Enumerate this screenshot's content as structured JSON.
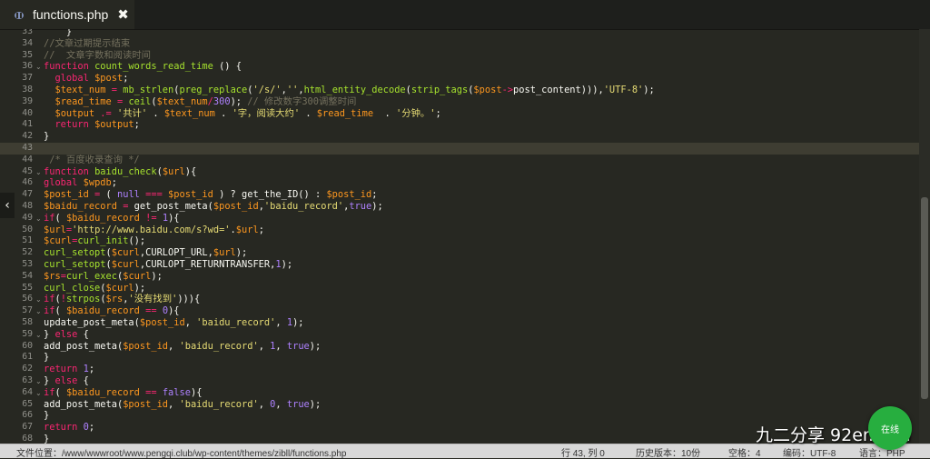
{
  "tab": {
    "title": "functions.php",
    "close": "✖"
  },
  "nav_arrow": "‹",
  "lines": [
    {
      "n": "33",
      "tokens": [
        [
          "    }",
          "plain"
        ]
      ]
    },
    {
      "n": "34",
      "tokens": [
        [
          "//文章过期提示结束",
          "com"
        ]
      ]
    },
    {
      "n": "35",
      "tokens": [
        [
          "//  文章字数和阅读时间",
          "com"
        ]
      ]
    },
    {
      "n": "36",
      "fold": true,
      "tokens": [
        [
          "function",
          "key"
        ],
        [
          " ",
          "plain"
        ],
        [
          "count_words_read_time",
          "fn"
        ],
        [
          " () {",
          "plain"
        ]
      ]
    },
    {
      "n": "37",
      "tokens": [
        [
          "  global",
          "key"
        ],
        [
          " ",
          "plain"
        ],
        [
          "$post",
          "var"
        ],
        [
          ";",
          "plain"
        ]
      ]
    },
    {
      "n": "38",
      "tokens": [
        [
          "  ",
          "plain"
        ],
        [
          "$text_num",
          "var"
        ],
        [
          " = ",
          "key"
        ],
        [
          "mb_strlen",
          "fn"
        ],
        [
          "(",
          "plain"
        ],
        [
          "preg_replace",
          "fn"
        ],
        [
          "(",
          "plain"
        ],
        [
          "'/s/'",
          "str"
        ],
        [
          ",",
          "plain"
        ],
        [
          "''",
          "str"
        ],
        [
          ",",
          "plain"
        ],
        [
          "html_entity_decode",
          "fn"
        ],
        [
          "(",
          "plain"
        ],
        [
          "strip_tags",
          "fn"
        ],
        [
          "(",
          "plain"
        ],
        [
          "$post",
          "var"
        ],
        [
          "->",
          "key"
        ],
        [
          "post_content",
          "plain"
        ],
        [
          "))),",
          "plain"
        ],
        [
          "'UTF-8'",
          "str"
        ],
        [
          ");",
          "plain"
        ]
      ]
    },
    {
      "n": "39",
      "tokens": [
        [
          "  ",
          "plain"
        ],
        [
          "$read_time",
          "var"
        ],
        [
          " = ",
          "key"
        ],
        [
          "ceil",
          "fn"
        ],
        [
          "(",
          "plain"
        ],
        [
          "$text_num",
          "var"
        ],
        [
          "/",
          "key"
        ],
        [
          "300",
          "num"
        ],
        [
          "); ",
          "plain"
        ],
        [
          "// 修改数字300调整时间",
          "com"
        ]
      ]
    },
    {
      "n": "40",
      "tokens": [
        [
          "  ",
          "plain"
        ],
        [
          "$output",
          "var"
        ],
        [
          " .= ",
          "key"
        ],
        [
          "'共计'",
          "str"
        ],
        [
          " . ",
          "plain"
        ],
        [
          "$text_num",
          "var"
        ],
        [
          " . ",
          "plain"
        ],
        [
          "'字，阅读大约'",
          "str"
        ],
        [
          " . ",
          "plain"
        ],
        [
          "$read_time",
          "var"
        ],
        [
          "  . ",
          "plain"
        ],
        [
          "'分钟。'",
          "str"
        ],
        [
          ";",
          "plain"
        ]
      ]
    },
    {
      "n": "41",
      "tokens": [
        [
          "  return",
          "key"
        ],
        [
          " ",
          "plain"
        ],
        [
          "$output",
          "var"
        ],
        [
          ";",
          "plain"
        ]
      ]
    },
    {
      "n": "42",
      "tokens": [
        [
          "}",
          "plain"
        ]
      ]
    },
    {
      "n": "43",
      "current": true,
      "tokens": []
    },
    {
      "n": "44",
      "tokens": [
        [
          " /* 百度收录查询 */",
          "com"
        ]
      ]
    },
    {
      "n": "45",
      "fold": true,
      "tokens": [
        [
          "function",
          "key"
        ],
        [
          " ",
          "plain"
        ],
        [
          "baidu_check",
          "fn"
        ],
        [
          "(",
          "plain"
        ],
        [
          "$url",
          "var"
        ],
        [
          "){",
          "plain"
        ]
      ]
    },
    {
      "n": "46",
      "tokens": [
        [
          "global",
          "key"
        ],
        [
          " ",
          "plain"
        ],
        [
          "$wpdb",
          "var"
        ],
        [
          ";",
          "plain"
        ]
      ]
    },
    {
      "n": "47",
      "tokens": [
        [
          "$post_id",
          "var"
        ],
        [
          " = ",
          "key"
        ],
        [
          "( ",
          "plain"
        ],
        [
          "null",
          "num"
        ],
        [
          " === ",
          "key"
        ],
        [
          "$post_id",
          "var"
        ],
        [
          " ) ? ",
          "plain"
        ],
        [
          "get_the_ID",
          "plain"
        ],
        [
          "() : ",
          "plain"
        ],
        [
          "$post_id",
          "var"
        ],
        [
          ";",
          "plain"
        ]
      ]
    },
    {
      "n": "48",
      "tokens": [
        [
          "$baidu_record",
          "var"
        ],
        [
          " = ",
          "key"
        ],
        [
          "get_post_meta",
          "plain"
        ],
        [
          "(",
          "plain"
        ],
        [
          "$post_id",
          "var"
        ],
        [
          ",",
          "plain"
        ],
        [
          "'baidu_record'",
          "str"
        ],
        [
          ",",
          "plain"
        ],
        [
          "true",
          "num"
        ],
        [
          ");",
          "plain"
        ]
      ]
    },
    {
      "n": "49",
      "fold": true,
      "tokens": [
        [
          "if",
          "key"
        ],
        [
          "( ",
          "plain"
        ],
        [
          "$baidu_record",
          "var"
        ],
        [
          " != ",
          "key"
        ],
        [
          "1",
          "num"
        ],
        [
          "){",
          "plain"
        ]
      ]
    },
    {
      "n": "50",
      "tokens": [
        [
          "$url",
          "var"
        ],
        [
          "=",
          "key"
        ],
        [
          "'http://www.baidu.com/s?wd='",
          "str"
        ],
        [
          ".",
          "plain"
        ],
        [
          "$url",
          "var"
        ],
        [
          ";",
          "plain"
        ]
      ]
    },
    {
      "n": "51",
      "tokens": [
        [
          "$curl",
          "var"
        ],
        [
          "=",
          "key"
        ],
        [
          "curl_init",
          "fn"
        ],
        [
          "();",
          "plain"
        ]
      ]
    },
    {
      "n": "52",
      "tokens": [
        [
          "curl_setopt",
          "fn"
        ],
        [
          "(",
          "plain"
        ],
        [
          "$curl",
          "var"
        ],
        [
          ",CURLOPT_URL,",
          "plain"
        ],
        [
          "$url",
          "var"
        ],
        [
          ");",
          "plain"
        ]
      ]
    },
    {
      "n": "53",
      "tokens": [
        [
          "curl_setopt",
          "fn"
        ],
        [
          "(",
          "plain"
        ],
        [
          "$curl",
          "var"
        ],
        [
          ",CURLOPT_RETURNTRANSFER,",
          "plain"
        ],
        [
          "1",
          "num"
        ],
        [
          ");",
          "plain"
        ]
      ]
    },
    {
      "n": "54",
      "tokens": [
        [
          "$rs",
          "var"
        ],
        [
          "=",
          "key"
        ],
        [
          "curl_exec",
          "fn"
        ],
        [
          "(",
          "plain"
        ],
        [
          "$curl",
          "var"
        ],
        [
          ");",
          "plain"
        ]
      ]
    },
    {
      "n": "55",
      "tokens": [
        [
          "curl_close",
          "fn"
        ],
        [
          "(",
          "plain"
        ],
        [
          "$curl",
          "var"
        ],
        [
          ");",
          "plain"
        ]
      ]
    },
    {
      "n": "56",
      "fold": true,
      "tokens": [
        [
          "if",
          "key"
        ],
        [
          "(",
          "plain"
        ],
        [
          "!",
          "key"
        ],
        [
          "strpos",
          "fn"
        ],
        [
          "(",
          "plain"
        ],
        [
          "$rs",
          "var"
        ],
        [
          ",",
          "plain"
        ],
        [
          "'没有找到'",
          "str"
        ],
        [
          "))){",
          "plain"
        ]
      ]
    },
    {
      "n": "57",
      "fold": true,
      "tokens": [
        [
          "if",
          "key"
        ],
        [
          "( ",
          "plain"
        ],
        [
          "$baidu_record",
          "var"
        ],
        [
          " == ",
          "key"
        ],
        [
          "0",
          "num"
        ],
        [
          "){",
          "plain"
        ]
      ]
    },
    {
      "n": "58",
      "tokens": [
        [
          "update_post_meta",
          "plain"
        ],
        [
          "(",
          "plain"
        ],
        [
          "$post_id",
          "var"
        ],
        [
          ", ",
          "plain"
        ],
        [
          "'baidu_record'",
          "str"
        ],
        [
          ", ",
          "plain"
        ],
        [
          "1",
          "num"
        ],
        [
          ");",
          "plain"
        ]
      ]
    },
    {
      "n": "59",
      "fold": true,
      "tokens": [
        [
          "} ",
          "plain"
        ],
        [
          "else",
          "key"
        ],
        [
          " {",
          "plain"
        ]
      ]
    },
    {
      "n": "60",
      "tokens": [
        [
          "add_post_meta",
          "plain"
        ],
        [
          "(",
          "plain"
        ],
        [
          "$post_id",
          "var"
        ],
        [
          ", ",
          "plain"
        ],
        [
          "'baidu_record'",
          "str"
        ],
        [
          ", ",
          "plain"
        ],
        [
          "1",
          "num"
        ],
        [
          ", ",
          "plain"
        ],
        [
          "true",
          "num"
        ],
        [
          ");",
          "plain"
        ]
      ]
    },
    {
      "n": "61",
      "tokens": [
        [
          "}",
          "plain"
        ]
      ]
    },
    {
      "n": "62",
      "tokens": [
        [
          "return",
          "key"
        ],
        [
          " ",
          "plain"
        ],
        [
          "1",
          "num"
        ],
        [
          ";",
          "plain"
        ]
      ]
    },
    {
      "n": "63",
      "fold": true,
      "tokens": [
        [
          "} ",
          "plain"
        ],
        [
          "else",
          "key"
        ],
        [
          " {",
          "plain"
        ]
      ]
    },
    {
      "n": "64",
      "fold": true,
      "tokens": [
        [
          "if",
          "key"
        ],
        [
          "( ",
          "plain"
        ],
        [
          "$baidu_record",
          "var"
        ],
        [
          " == ",
          "key"
        ],
        [
          "false",
          "num"
        ],
        [
          "){",
          "plain"
        ]
      ]
    },
    {
      "n": "65",
      "tokens": [
        [
          "add_post_meta",
          "plain"
        ],
        [
          "(",
          "plain"
        ],
        [
          "$post_id",
          "var"
        ],
        [
          ", ",
          "plain"
        ],
        [
          "'baidu_record'",
          "str"
        ],
        [
          ", ",
          "plain"
        ],
        [
          "0",
          "num"
        ],
        [
          ", ",
          "plain"
        ],
        [
          "true",
          "num"
        ],
        [
          ");",
          "plain"
        ]
      ]
    },
    {
      "n": "66",
      "tokens": [
        [
          "}",
          "plain"
        ]
      ]
    },
    {
      "n": "67",
      "tokens": [
        [
          "return",
          "key"
        ],
        [
          " ",
          "plain"
        ],
        [
          "0",
          "num"
        ],
        [
          ";",
          "plain"
        ]
      ]
    },
    {
      "n": "68",
      "tokens": [
        [
          "}",
          "plain"
        ]
      ]
    }
  ],
  "status": {
    "path": "文件位置：/www/wwwroot/www.pengqi.club/wp-content/themes/zibll/functions.php",
    "cursor": "行 43, 列 0",
    "history": "历史版本：10份",
    "indent": "空格：4",
    "encoding": "编码：UTF-8",
    "language": "语言：PHP"
  },
  "watermark": "九二分享 92er.com",
  "chat_button": "在线"
}
